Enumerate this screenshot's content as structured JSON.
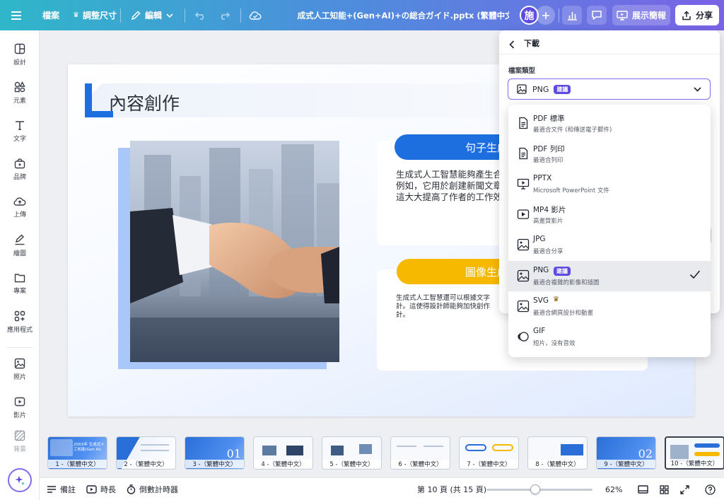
{
  "topbar": {
    "menu_icon": "hamburger-icon",
    "file_label": "檔案",
    "resize_label": "調整尺寸",
    "edit_label": "編輯",
    "doc_title": "生成式人工知能+(Gen+AI)+の総合ガイド.pptx (繁體中文)",
    "avatar_initial": "施",
    "present_label": "展示簡報",
    "share_label": "分享",
    "colors": {
      "gradient_start": "#2fb7c9",
      "gradient_end": "#7a63e6"
    }
  },
  "sidebar": {
    "items": [
      {
        "label": "設計",
        "icon": "design-icon"
      },
      {
        "label": "元素",
        "icon": "elements-icon"
      },
      {
        "label": "文字",
        "icon": "text-icon"
      },
      {
        "label": "品牌",
        "icon": "brand-icon"
      },
      {
        "label": "上傳",
        "icon": "upload-icon"
      },
      {
        "label": "繪圖",
        "icon": "draw-icon"
      },
      {
        "label": "專案",
        "icon": "folder-icon"
      },
      {
        "label": "應用程式",
        "icon": "apps-icon"
      },
      {
        "label": "照片",
        "icon": "photo-icon"
      },
      {
        "label": "影片",
        "icon": "video-icon"
      },
      {
        "label": "背景",
        "icon": "background-icon"
      }
    ]
  },
  "slide": {
    "title": "內容創作",
    "section1_title": "句子生成",
    "section1_text": "生成式人工智慧能夠產生合\n例如，它用於創建新聞文章\n這大大提高了作者的工作效",
    "section2_title": "圖像生成",
    "section2_text": "生成式人工智慧還可以根據文字\n計。這使得設計師能夠加快創作\n計。"
  },
  "download_panel": {
    "title": "下載",
    "file_type_label": "檔案類型",
    "selected_type": "PNG",
    "selected_badge": "建議",
    "options": [
      {
        "name": "PDF 標準",
        "desc": "最適合文件 (和傳送電子郵件)",
        "icon": "document-icon"
      },
      {
        "name": "PDF 列印",
        "desc": "最適合列印",
        "icon": "document-icon"
      },
      {
        "name": "PPTX",
        "desc": "Microsoft PowerPoint 文件",
        "icon": "presentation-icon"
      },
      {
        "name": "MP4 影片",
        "desc": "高畫質影片",
        "icon": "video-icon"
      },
      {
        "name": "JPG",
        "desc": "最適合分享",
        "icon": "image-icon"
      },
      {
        "name": "PNG",
        "badge": "建議",
        "desc": "最適合複雜的影像和插圖",
        "icon": "image-icon",
        "selected": true
      },
      {
        "name": "SVG",
        "desc": "最適合網頁設計和動畫",
        "icon": "image-icon",
        "crown": true
      },
      {
        "name": "GIF",
        "desc": "短片，沒有音效",
        "icon": "gif-icon"
      }
    ]
  },
  "filmstrip": {
    "thumbs": [
      {
        "label": "1 -（繁體中文）",
        "num": "",
        "heading": "20XX年 生成式人工知能(Gen AI)"
      },
      {
        "label": "2 -（繁體中文）",
        "num": ""
      },
      {
        "label": "3 -（繁體中文）",
        "num": "01"
      },
      {
        "label": "4 -（繁體中文）",
        "num": ""
      },
      {
        "label": "5 -（繁體中文）",
        "num": ""
      },
      {
        "label": "6 -（繁體中文）",
        "num": ""
      },
      {
        "label": "7 -（繁體中文）",
        "num": ""
      },
      {
        "label": "8 -（繁體中文）",
        "num": ""
      },
      {
        "label": "9 -（繁體中文）",
        "num": "02"
      },
      {
        "label": "10 -（繁體中文）",
        "num": "",
        "active": true
      }
    ]
  },
  "bottombar": {
    "notes_label": "備註",
    "duration_label": "時長",
    "timer_label": "倒數計時器",
    "page_indicator": "第 10 頁 (共 15 頁)",
    "zoom": "62%"
  }
}
